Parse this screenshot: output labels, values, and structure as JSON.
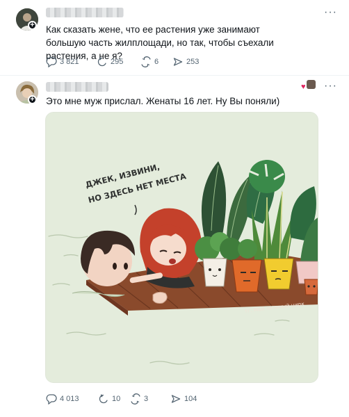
{
  "post1": {
    "text": "Как сказать жене, что ее растения уже занимают большую часть жилплощади, но так, чтобы съехали растения, а не я?",
    "stats": {
      "replies": "3 821",
      "retweets": "295",
      "likes": "6",
      "views": "253"
    }
  },
  "post2": {
    "text": "Это мне муж прислал. Женаты 16 лет. Ну Вы поняли)",
    "media": {
      "speech_line1": "ДЖЕК, ИЗВИНИ,",
      "speech_line2": "НО ЗДЕСЬ НЕТ МЕСТА",
      "watermark": "тг: Мой зеленый цирк"
    },
    "stats": {
      "replies": "4 013",
      "retweets": "10",
      "likes": "3",
      "views": "104"
    }
  },
  "icons": [
    "reply-icon",
    "retweet-icon",
    "like-icon",
    "views-icon",
    "more-icon",
    "heart-badge-icon"
  ],
  "colors": {
    "text": "#0f1419",
    "muted": "#536471",
    "water": "#e7efe0"
  }
}
